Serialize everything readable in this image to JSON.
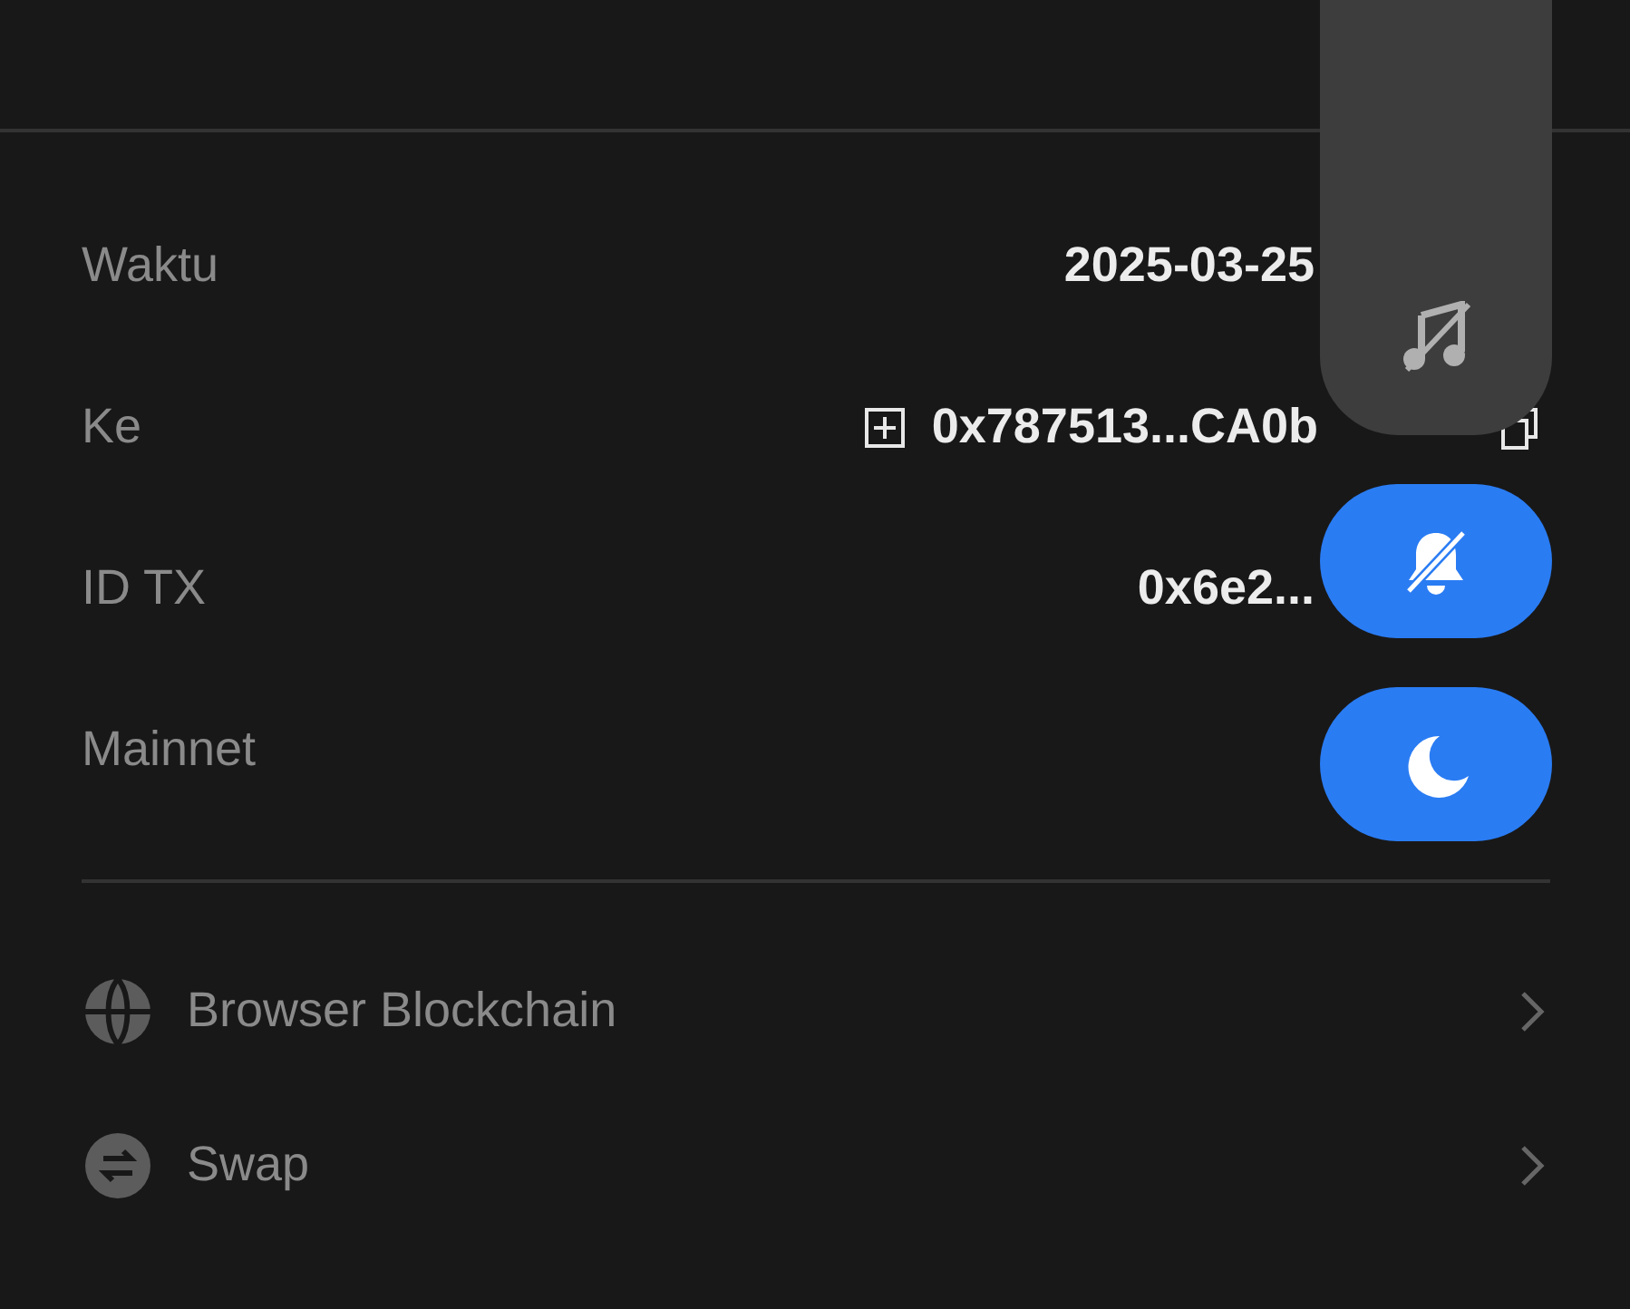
{
  "details": [
    {
      "label": "Waktu",
      "kind": "text",
      "value": "2025-03-25"
    },
    {
      "label": "Ke",
      "kind": "address",
      "value": "0x787513...CA0b"
    },
    {
      "label": "ID TX",
      "kind": "text",
      "value": "0x6e2..."
    },
    {
      "label": "Mainnet",
      "kind": "empty"
    }
  ],
  "links": [
    {
      "label": "Browser Blockchain",
      "kind": "globe"
    },
    {
      "label": "Swap",
      "kind": "swap"
    }
  ],
  "overlay": {
    "buttons": [
      {
        "kind": "music-off",
        "selected": false
      },
      {
        "kind": "bell-off",
        "selected": true
      },
      {
        "kind": "moon",
        "selected": true
      }
    ]
  }
}
